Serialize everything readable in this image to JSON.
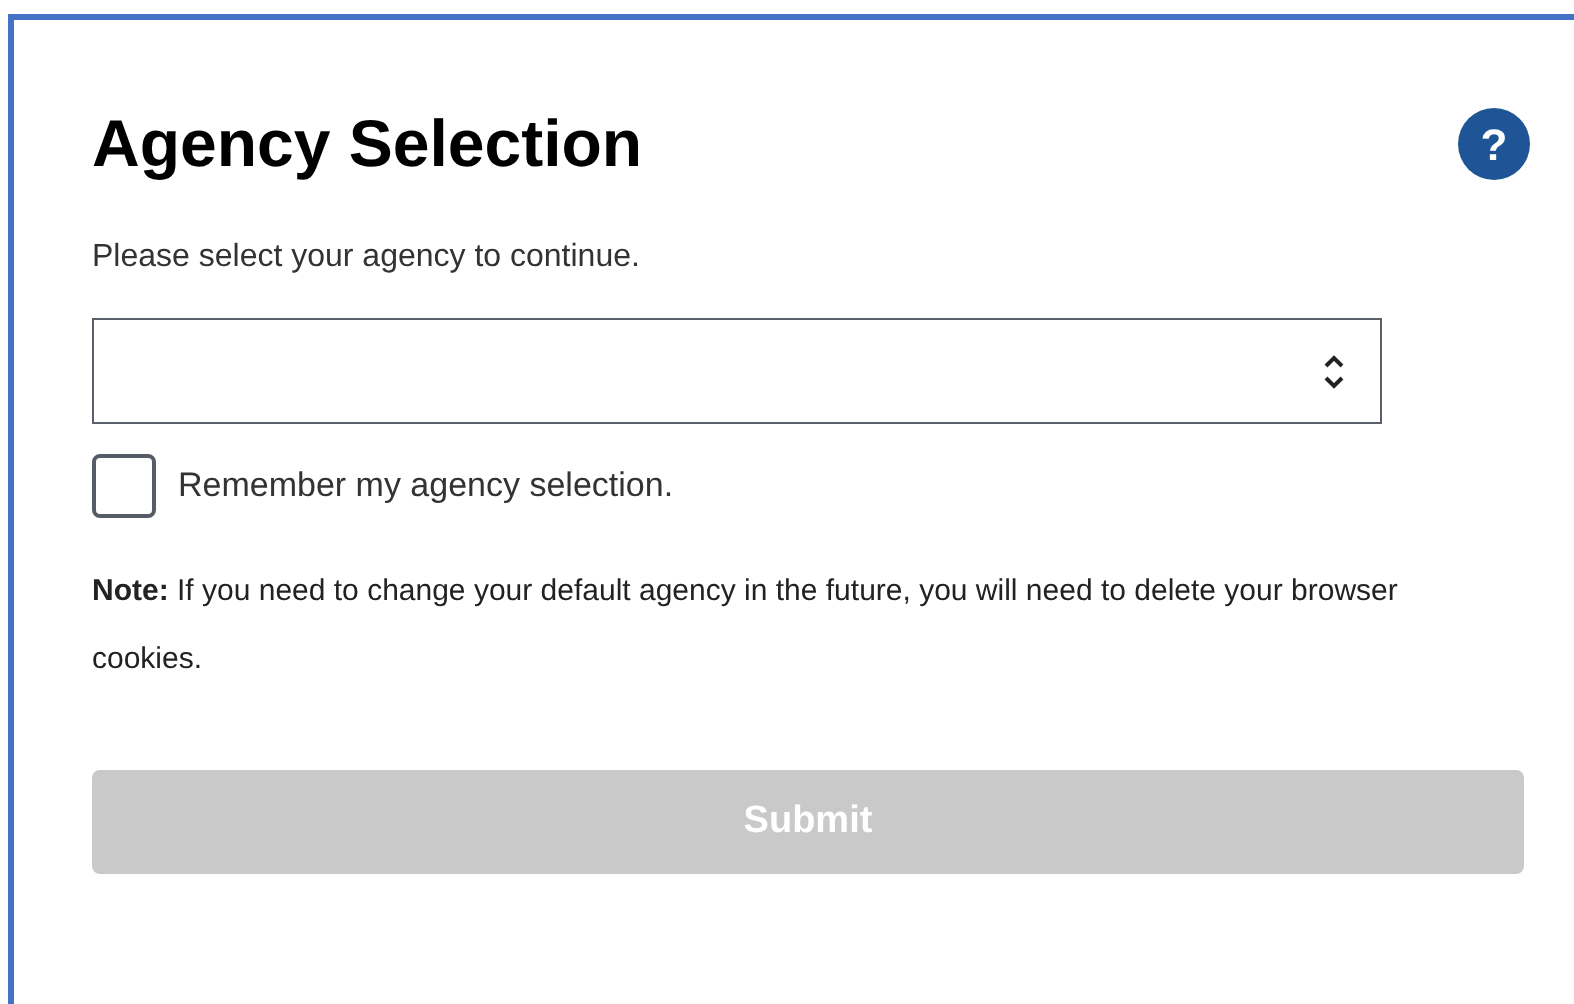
{
  "title": "Agency Selection",
  "help": {
    "glyph": "?"
  },
  "instruction": "Please select your agency to continue.",
  "agency_select": {
    "kind": "dropdown"
  },
  "remember": {
    "label": "Remember my agency selection.",
    "checked": false
  },
  "note": "**Note:** If you need to change your default agency in the future, you will need to delete your browser cookies.",
  "submit": {
    "label": "Submit",
    "disabled": true
  }
}
